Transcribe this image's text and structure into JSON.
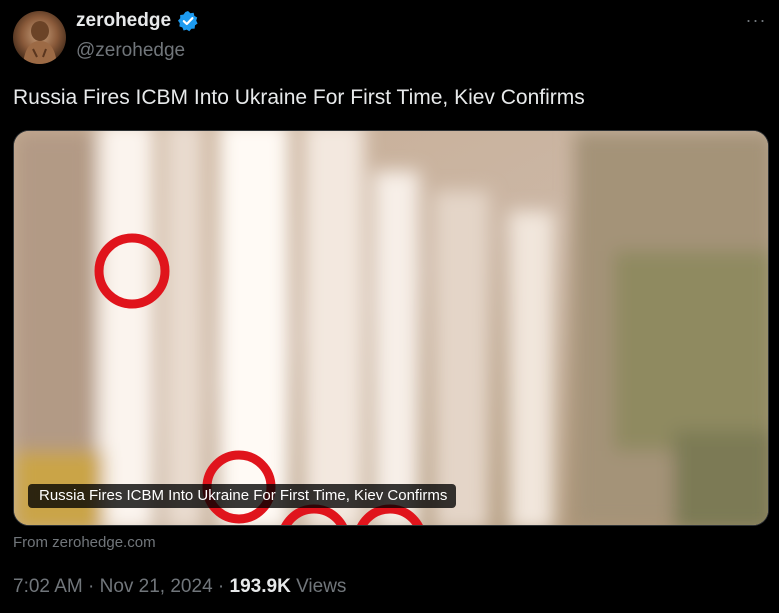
{
  "tweet": {
    "display_name": "zerohedge",
    "handle": "@zerohedge",
    "text": "Russia Fires ICBM Into Ukraine For First Time, Kiev Confirms",
    "more_label": "···"
  },
  "card": {
    "caption": "Russia Fires ICBM Into Ukraine For First Time, Kiev Confirms",
    "source": "From zerohedge.com",
    "circle_color": "#e0141c"
  },
  "meta": {
    "time": "7:02 AM",
    "sep1": " · ",
    "date": "Nov 21, 2024",
    "sep2": " · ",
    "views_count": "193.9K",
    "views_label": " Views"
  },
  "icons": {
    "verified": "verified-badge-icon",
    "more": "more-options-icon"
  },
  "colors": {
    "background": "#000000",
    "text": "#e7e9ea",
    "muted": "#71767b",
    "verified": "#1d9bf0"
  }
}
